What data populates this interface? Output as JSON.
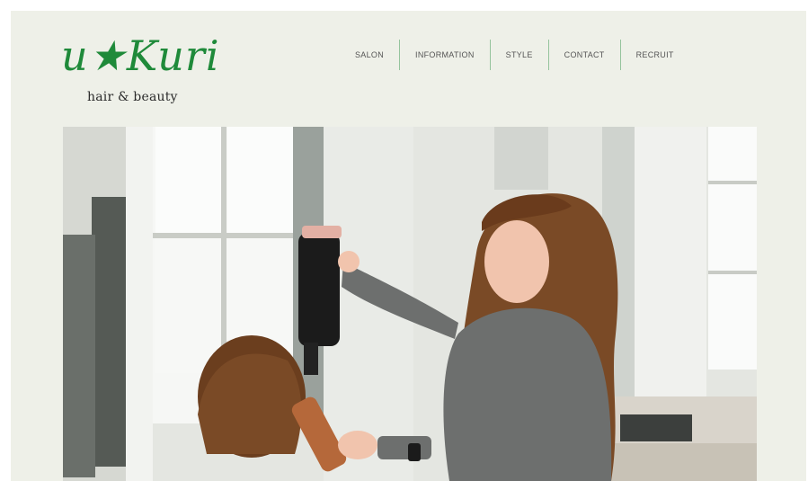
{
  "brand": {
    "logo_text": "u★Kuri",
    "tagline": "hair & beauty",
    "brand_color": "#1f8a3a"
  },
  "nav": {
    "items": [
      {
        "label": "SALON"
      },
      {
        "label": "INFORMATION"
      },
      {
        "label": "STYLE"
      },
      {
        "label": "CONTACT"
      },
      {
        "label": "RECRUIT"
      }
    ]
  },
  "hero": {
    "image": "hairdresser-blow-drying-client-photo"
  }
}
